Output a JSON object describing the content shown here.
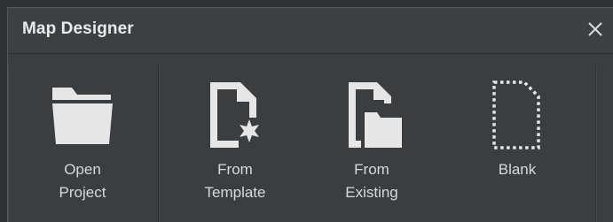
{
  "window": {
    "title": "Map Designer",
    "close_icon": "close-icon"
  },
  "options": [
    {
      "id": "open-project",
      "icon": "folder-icon",
      "lines": [
        "Open",
        "Project"
      ]
    },
    {
      "id": "from-template",
      "icon": "template-document-icon",
      "lines": [
        "From",
        "Template"
      ]
    },
    {
      "id": "from-existing",
      "icon": "existing-document-folder-icon",
      "lines": [
        "From",
        "Existing"
      ]
    },
    {
      "id": "blank",
      "icon": "blank-document-icon",
      "lines": [
        "Blank"
      ]
    }
  ],
  "colors": {
    "background": "#3b3e41",
    "title_text": "#e9eaea",
    "icon_fill": "#e6e6e6",
    "label_text": "#d8d9da"
  }
}
